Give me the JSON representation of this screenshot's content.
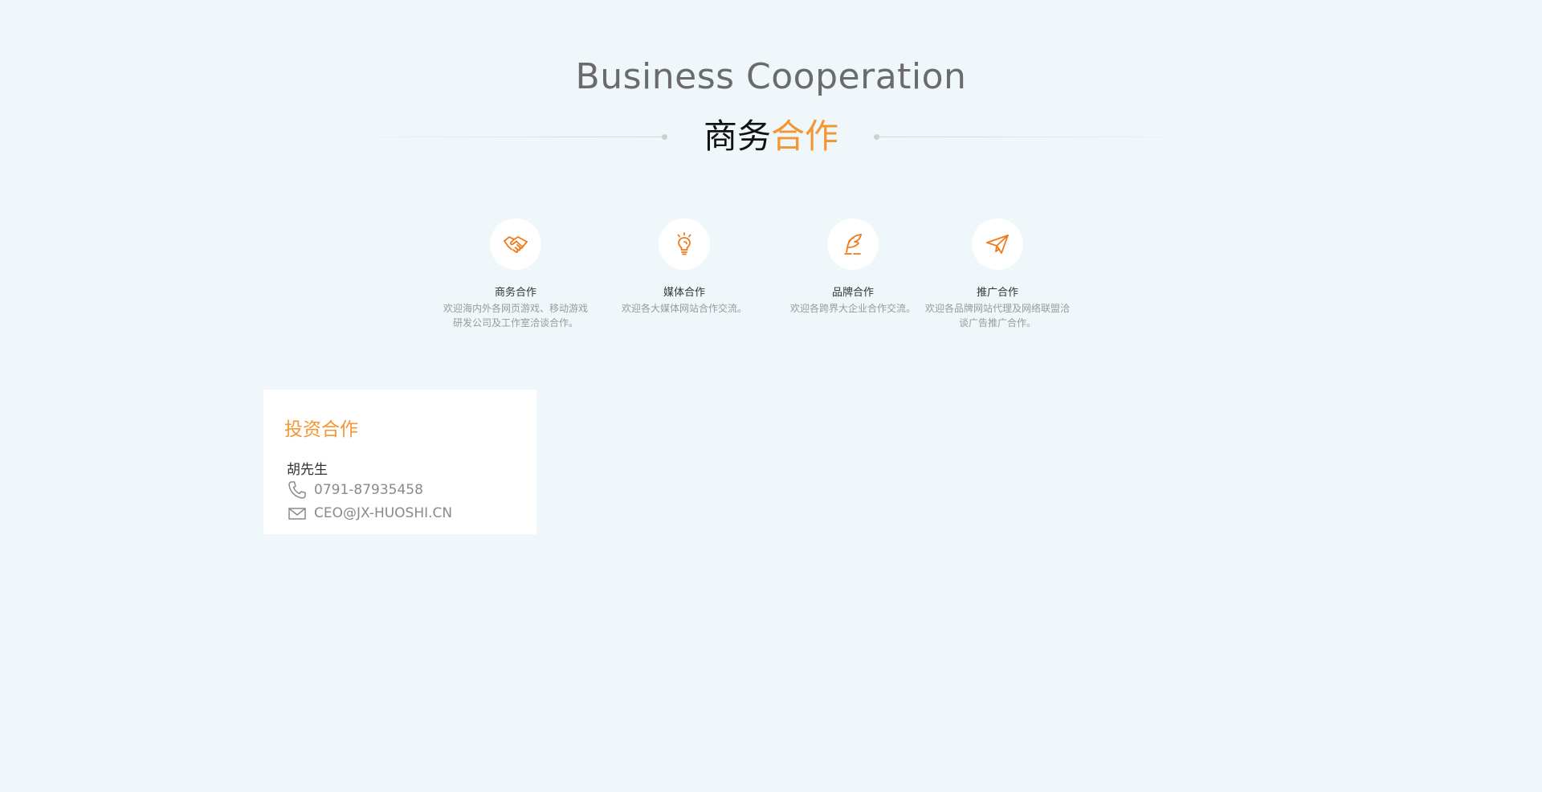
{
  "header": {
    "en_title": "Business Cooperation",
    "cn_title_dark": "商务",
    "cn_title_orange": "合作"
  },
  "colors": {
    "accent": "#f39634",
    "background": "#eff7fa",
    "card": "#ffffff"
  },
  "cooperation": [
    {
      "icon": "handshake-icon",
      "name": "商务合作",
      "desc": "欢迎海内外各网页游戏、移动游戏研发公司及工作室洽谈合作。"
    },
    {
      "icon": "lightbulb-icon",
      "name": "媒体合作",
      "desc": "欢迎各大媒体网站合作交流。"
    },
    {
      "icon": "quill-icon",
      "name": "品牌合作",
      "desc": "欢迎各跨界大企业合作交流。"
    },
    {
      "icon": "paper-plane-icon",
      "name": "推广合作",
      "desc": "欢迎各品牌网站代理及网络联盟洽谈广告推广合作。"
    }
  ],
  "contact": {
    "title": "投资合作",
    "name": "胡先生",
    "phone_icon": "phone-icon",
    "phone": "0791-87935458",
    "email_icon": "mail-icon",
    "email": "CEO@JX-HUOSHI.CN"
  }
}
